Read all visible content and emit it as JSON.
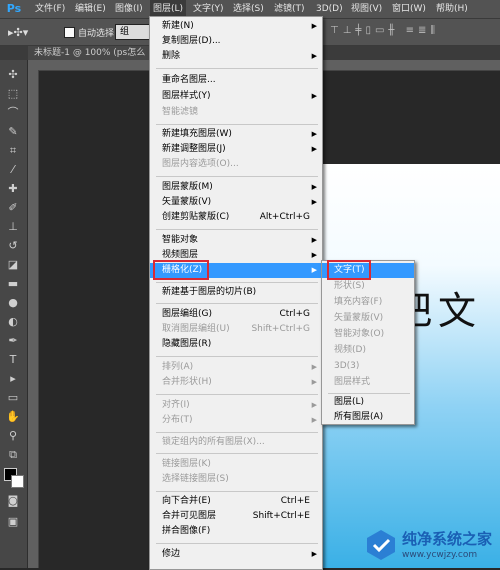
{
  "menubar": {
    "logo": "Ps",
    "items": [
      {
        "label": "文件(F)"
      },
      {
        "label": "编辑(E)"
      },
      {
        "label": "图像(I)"
      },
      {
        "label": "图层(L)"
      },
      {
        "label": "文字(Y)"
      },
      {
        "label": "选择(S)"
      },
      {
        "label": "滤镜(T)"
      },
      {
        "label": "3D(D)"
      },
      {
        "label": "视图(V)"
      },
      {
        "label": "窗口(W)"
      },
      {
        "label": "帮助(H)"
      }
    ]
  },
  "options_bar": {
    "auto_select_label": "自动选择:",
    "auto_select_value": "组"
  },
  "document_tab": "未标题-1 @ 100% (ps怎么",
  "document_text": "么把文",
  "layer_menu": [
    {
      "label": "新建(N)",
      "arrow": true
    },
    {
      "label": "复制图层(D)..."
    },
    {
      "label": "删除",
      "arrow": true
    },
    {
      "label": "重命名图层..."
    },
    {
      "label": "图层样式(Y)",
      "arrow": true
    },
    {
      "label": "智能滤镜",
      "disabled": true
    },
    {
      "label": "新建填充图层(W)",
      "arrow": true
    },
    {
      "label": "新建调整图层(J)",
      "arrow": true
    },
    {
      "label": "图层内容选项(O)...",
      "disabled": true
    },
    {
      "label": "图层蒙版(M)",
      "arrow": true
    },
    {
      "label": "矢量蒙版(V)",
      "arrow": true
    },
    {
      "label": "创建剪贴蒙版(C)",
      "shortcut": "Alt+Ctrl+G"
    },
    {
      "label": "智能对象",
      "arrow": true
    },
    {
      "label": "视频图层",
      "arrow": true
    },
    {
      "label": "栅格化(Z)",
      "arrow": true,
      "highlighted": true
    },
    {
      "label": "新建基于图层的切片(B)"
    },
    {
      "label": "图层编组(G)",
      "shortcut": "Ctrl+G"
    },
    {
      "label": "取消图层编组(U)",
      "shortcut": "Shift+Ctrl+G",
      "disabled": true
    },
    {
      "label": "隐藏图层(R)"
    },
    {
      "label": "排列(A)",
      "arrow": true,
      "disabled": true
    },
    {
      "label": "合并形状(H)",
      "arrow": true,
      "disabled": true
    },
    {
      "label": "对齐(I)",
      "arrow": true,
      "disabled": true
    },
    {
      "label": "分布(T)",
      "arrow": true,
      "disabled": true
    },
    {
      "label": "锁定组内的所有图层(X)...",
      "disabled": true
    },
    {
      "label": "链接图层(K)",
      "disabled": true
    },
    {
      "label": "选择链接图层(S)",
      "disabled": true
    },
    {
      "label": "向下合并(E)",
      "shortcut": "Ctrl+E"
    },
    {
      "label": "合并可见图层",
      "shortcut": "Shift+Ctrl+E"
    },
    {
      "label": "拼合图像(F)"
    },
    {
      "label": "修边",
      "arrow": true
    }
  ],
  "rasterize_submenu": [
    {
      "label": "文字(T)",
      "highlighted": true
    },
    {
      "label": "形状(S)",
      "disabled": true
    },
    {
      "label": "填充内容(F)",
      "disabled": true
    },
    {
      "label": "矢量蒙版(V)",
      "disabled": true
    },
    {
      "label": "智能对象(O)",
      "disabled": true
    },
    {
      "label": "视频(D)",
      "disabled": true
    },
    {
      "label": "3D(3)",
      "disabled": true
    },
    {
      "label": "图层样式",
      "disabled": true
    },
    {
      "label": "图层(L)"
    },
    {
      "label": "所有图层(A)"
    }
  ],
  "watermark": {
    "title": "纯净系统之家",
    "url": "www.ycwjzy.com"
  },
  "colors": {
    "highlight": "#3399ff",
    "annotation": "#d92a35",
    "ps_blue": "#31a8ff"
  }
}
